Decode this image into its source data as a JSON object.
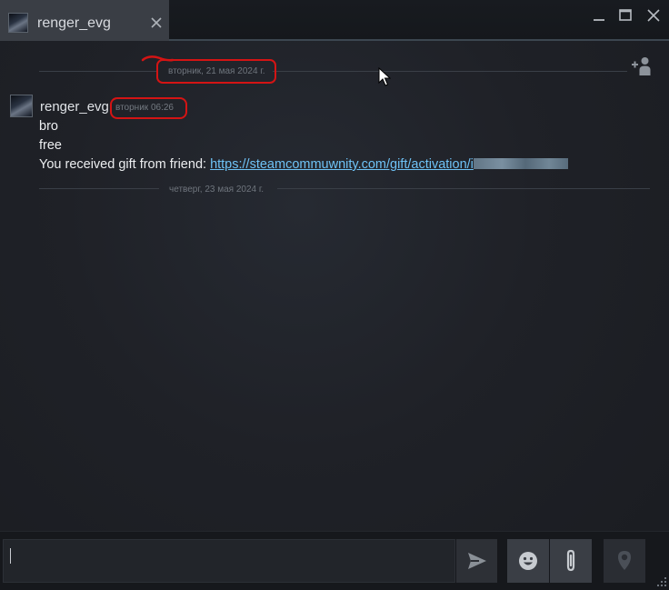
{
  "tab": {
    "name": "renger_evg",
    "close_icon": "close-icon"
  },
  "window_controls": {
    "minimize_icon": "minimize-icon",
    "maximize_icon": "maximize-icon",
    "close_icon": "close-icon"
  },
  "chat": {
    "dividers": [
      {
        "date": "вторник, 21 мая 2024 г."
      },
      {
        "date": "четверг, 23 мая 2024 г."
      }
    ],
    "add_friend_icon": "add-friend-icon",
    "message": {
      "author": "renger_evg",
      "time": "вторник 06:26",
      "lines": [
        {
          "text": "bro"
        },
        {
          "text": "free"
        },
        {
          "prefix": "You received gift from friend: ",
          "link": "https://steamcommuwnity.com/gift/activation/i"
        }
      ]
    }
  },
  "input": {
    "value": "",
    "send_icon": "send-icon",
    "emoji_icon": "emoji-icon",
    "attach_icon": "paperclip-icon",
    "voice_icon": "microphone-icon"
  },
  "colors": {
    "background": "#1f2127",
    "tab_active": "#3a3e45",
    "link": "#6ec2f5",
    "annotation": "#d41414"
  }
}
